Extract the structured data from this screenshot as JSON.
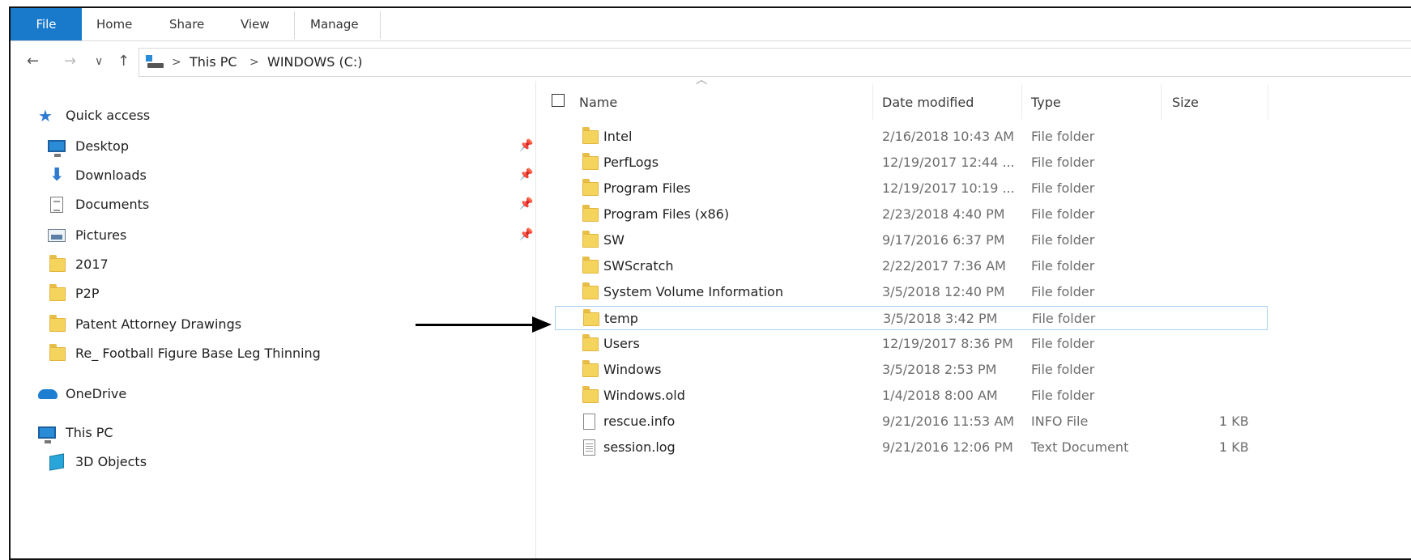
{
  "ribbon": {
    "tabs": [
      "File",
      "Home",
      "Share",
      "View",
      "Manage"
    ]
  },
  "address": {
    "crumbs": [
      "This PC",
      "WINDOWS (C:)"
    ],
    "separator": ">"
  },
  "nav_buttons": {
    "back": "←",
    "forward": "→",
    "recent": "∨",
    "up": "↑"
  },
  "navpane": {
    "quick_access": "Quick access",
    "pinned": [
      "Desktop",
      "Downloads",
      "Documents",
      "Pictures"
    ],
    "folders": [
      "2017",
      "P2P",
      "Patent Attorney Drawings",
      "Re_ Football Figure Base Leg Thinning"
    ],
    "onedrive": "OneDrive",
    "this_pc": "This PC",
    "objects3d": "3D Objects"
  },
  "columns": {
    "name": "Name",
    "date": "Date modified",
    "type": "Type",
    "size": "Size"
  },
  "files": [
    {
      "name": "Intel",
      "date": "2/16/2018 10:43 AM",
      "type": "File folder",
      "size": ""
    },
    {
      "name": "PerfLogs",
      "date": "12/19/2017 12:44 ...",
      "type": "File folder",
      "size": ""
    },
    {
      "name": "Program Files",
      "date": "12/19/2017 10:19 ...",
      "type": "File folder",
      "size": ""
    },
    {
      "name": "Program Files (x86)",
      "date": "2/23/2018 4:40 PM",
      "type": "File folder",
      "size": ""
    },
    {
      "name": "SW",
      "date": "9/17/2016 6:37 PM",
      "type": "File folder",
      "size": ""
    },
    {
      "name": "SWScratch",
      "date": "2/22/2017 7:36 AM",
      "type": "File folder",
      "size": ""
    },
    {
      "name": "System Volume Information",
      "date": "3/5/2018 12:40 PM",
      "type": "File folder",
      "size": ""
    },
    {
      "name": "temp",
      "date": "3/5/2018 3:42 PM",
      "type": "File folder",
      "size": ""
    },
    {
      "name": "Users",
      "date": "12/19/2017 8:36 PM",
      "type": "File folder",
      "size": ""
    },
    {
      "name": "Windows",
      "date": "3/5/2018 2:53 PM",
      "type": "File folder",
      "size": ""
    },
    {
      "name": "Windows.old",
      "date": "1/4/2018 8:00 AM",
      "type": "File folder",
      "size": ""
    },
    {
      "name": "rescue.info",
      "date": "9/21/2016 11:53 AM",
      "type": "INFO File",
      "size": "1 KB"
    },
    {
      "name": "session.log",
      "date": "9/21/2016 12:06 PM",
      "type": "Text Document",
      "size": "1 KB"
    }
  ],
  "colors": {
    "file_tab": "#1979ca",
    "selection_border": "#a8d2f4",
    "folder": "#f5d45e"
  }
}
